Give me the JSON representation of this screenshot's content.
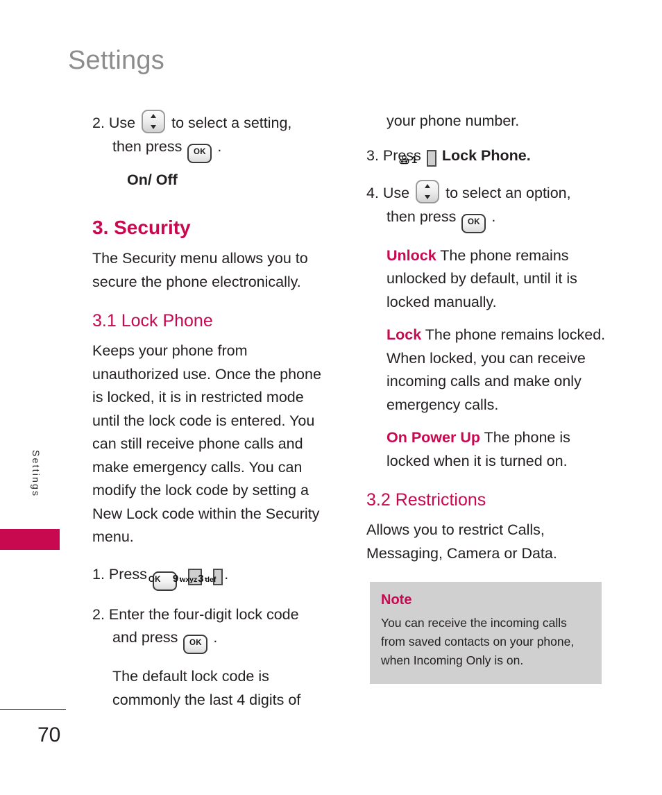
{
  "page": {
    "title": "Settings",
    "side_tab_label": "Settings",
    "page_number": "70"
  },
  "colors": {
    "accent": "#c8084f",
    "title_gray": "#8c8c8c",
    "note_bg": "#d0d0d0",
    "text": "#231f20"
  },
  "keys": {
    "ok": "OK",
    "nav": "nav-up-down",
    "k9_num": "9",
    "k9_letters": "wxyz",
    "k3_num": "3",
    "k3_letters": "def",
    "k1_num": "1",
    "k1_glyph": "voicemail"
  },
  "left_column": {
    "step2_pre": "2. Use",
    "step2_mid": "to select a setting,",
    "step2_cont_pre": "then press",
    "step2_cont_post": ".",
    "onoff": "On/ Off",
    "section_heading": "3. Security",
    "section_intro": "The Security menu allows you to secure the phone electronically.",
    "sub_heading": "3.1 Lock Phone",
    "lock_phone_body": "Keeps your phone from unauthorized use. Once the phone is locked, it is in restricted mode until the lock code is entered. You can still receive phone calls and make emergency calls. You can modify the lock code by setting a New Lock code within the Security menu.",
    "step1_pre": "1. Press",
    "step1_sep1": ",",
    "step1_sep2": ",",
    "step1_end": ".",
    "step2b_line1": "2. Enter the four-digit lock code",
    "step2b_line2_pre": "and press",
    "step2b_line2_post": ".",
    "default_code_note": "The default lock code is commonly the last 4 digits of"
  },
  "right_column": {
    "continued": "your phone number.",
    "step3_pre": "3. Press",
    "step3_post": "Lock Phone.",
    "step4_pre": "4. Use",
    "step4_mid": "to select an option,",
    "step4_cont_pre": "then press",
    "step4_cont_post": ".",
    "options": [
      {
        "label": "Unlock",
        "text": "The phone remains unlocked by default, until it is locked manually."
      },
      {
        "label": "Lock",
        "text": "The phone remains locked. When locked, you can receive incoming calls and make only emergency calls."
      },
      {
        "label": "On Power Up",
        "text": "The phone is locked when it is turned on."
      }
    ],
    "sub_heading": "3.2 Restrictions",
    "restrictions_body": "Allows you to restrict Calls, Messaging, Camera or Data.",
    "note": {
      "title": "Note",
      "body": "You can receive the incoming calls from saved contacts on your phone, when Incoming Only is on."
    }
  }
}
